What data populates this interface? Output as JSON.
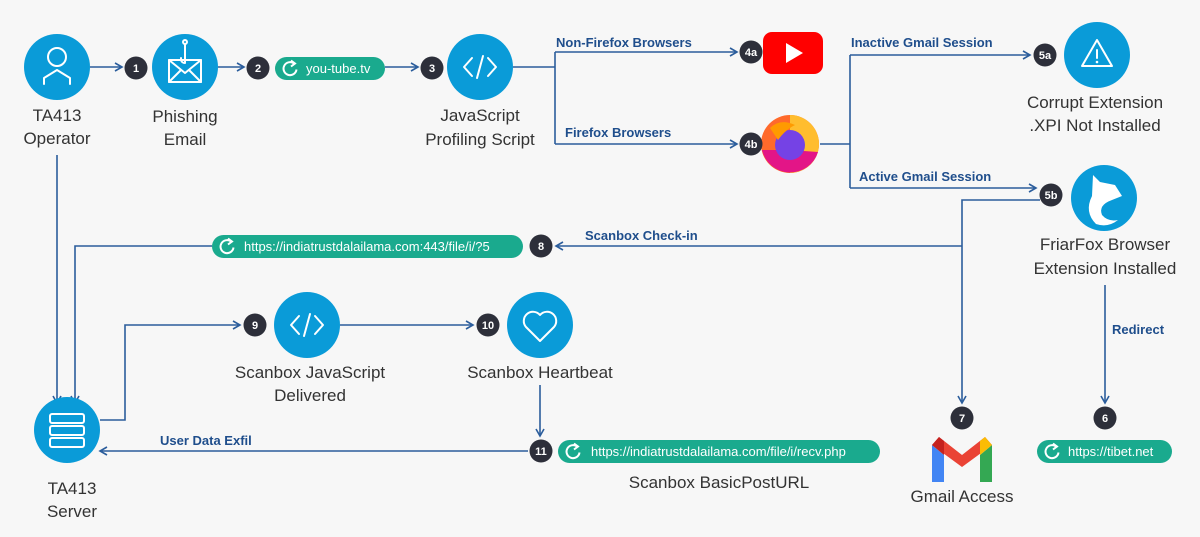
{
  "colors": {
    "node": "#0a9bd8",
    "line": "#2b5d9c",
    "badge": "#2d2f3a",
    "pill": "#1aaa8e",
    "youtube": "#ff0000"
  },
  "nodes": {
    "operator": {
      "line1": "TA413",
      "line2": "Operator",
      "icon": "user-icon"
    },
    "phishing": {
      "line1": "Phishing",
      "line2": "Email",
      "icon": "phishing-email-icon"
    },
    "profiling": {
      "line1": "JavaScript",
      "line2": "Profiling Script",
      "icon": "code-icon"
    },
    "youtube": {
      "icon": "youtube-icon"
    },
    "firefox": {
      "icon": "firefox-icon"
    },
    "corrupt": {
      "line1": "Corrupt Extension",
      "line2": ".XPI Not Installed",
      "icon": "warning-icon"
    },
    "friarfox": {
      "line1": "FriarFox Browser",
      "line2": "Extension Installed",
      "icon": "fox-icon"
    },
    "server": {
      "line1": "TA413",
      "line2": "Server",
      "icon": "server-icon"
    },
    "scanbox_js": {
      "line1": "Scanbox JavaScript",
      "line2": "Delivered",
      "icon": "code-icon"
    },
    "heartbeat": {
      "line1": "Scanbox Heartbeat",
      "icon": "heart-icon"
    },
    "basicpost": {
      "line1": "Scanbox BasicPostURL"
    },
    "gmail": {
      "line1": "Gmail Access",
      "icon": "gmail-icon"
    }
  },
  "badges": {
    "b1": "1",
    "b2": "2",
    "b3": "3",
    "b4a": "4a",
    "b4b": "4b",
    "b5a": "5a",
    "b5b": "5b",
    "b6": "6",
    "b7": "7",
    "b8": "8",
    "b9": "9",
    "b10": "10",
    "b11": "11"
  },
  "pills": {
    "youtube_url": "you-tube.tv",
    "checkin_url": "https://indiatrustdalailama.com:443/file/i/?5",
    "recv_url": "https://indiatrustdalailama.com/file/i/recv.php",
    "tibet_url": "https://tibet.net"
  },
  "edges": {
    "non_firefox": "Non-Firefox Browsers",
    "firefox": "Firefox Browsers",
    "inactive": "Inactive Gmail Session",
    "active": "Active Gmail Session",
    "checkin": "Scanbox Check-in",
    "exfil": "User Data Exfil",
    "redirect": "Redirect"
  }
}
